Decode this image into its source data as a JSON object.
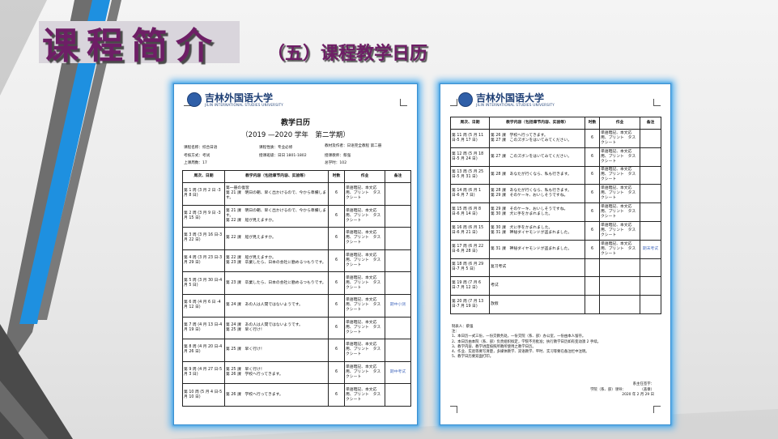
{
  "slide": {
    "title": "课程简介",
    "subtitle": "（五）课程教学日历",
    "colors": {
      "title": "#6e1e66",
      "glow": "#5ab3ef",
      "stripe_blue": "#1e90e0",
      "stripe_gray": "#6e6e6e"
    }
  },
  "logo": {
    "cn": "吉林外国语大学",
    "en": "JILIN INTERNATIONAL STUDIES UNIVERSITY"
  },
  "page1": {
    "doc_title": "教学日历",
    "year_line": "（2019 —2020 学年　第二学期）",
    "info": [
      "课程名称：综合日语",
      "课程性质：专业必修",
      "教材及作者：日语完全教程 第二册",
      "考核方式：考试",
      "授课班级：日日 1801-1802",
      "授课教师：蔡强",
      "上课周数：17",
      "总学时：102"
    ],
    "headers": [
      "周次、日期",
      "教学内容（包括章节内容、实验等）",
      "时数",
      "作业",
      "备注"
    ],
    "rows": [
      {
        "week": "第 1 周 (3 月 2 日 -3 月 8 日)",
        "content": "第一册の復習\n第 21 課　明日の朝、早く出かけるので、今から準備します。",
        "hours": "6",
        "homework": "単語暗記、本文応用、プリント　タスクシート",
        "note": ""
      },
      {
        "week": "第 2 周 (3 月 9 日 -3 月 15 日)",
        "content": "第 21 課　明日の朝、早く出かけるので、今から準備します。\n第 22 課　船が見えますか。",
        "hours": "6",
        "homework": "単語暗記、本文応用、プリント　タスクシート",
        "note": ""
      },
      {
        "week": "第 3 周 (3 月 16 日-3 月 22 日)",
        "content": "第 22 課　船が見えますか。",
        "hours": "6",
        "homework": "単語暗記、本文応用、プリント　タスクシート",
        "note": ""
      },
      {
        "week": "第 4 周 (3 月 23 日-3 月 29 日)",
        "content": "第 22 課　船が見えますか。\n第 23 課　卒業したら、日本の会社に勤めるつもりです。",
        "hours": "6",
        "homework": "単語暗記、本文応用、プリント　タスクシート",
        "note": ""
      },
      {
        "week": "第 5 周 (3 月 30 日-4 月 5 日)",
        "content": "第 23 課　卒業したら、日本の会社に勤めるつもりです。",
        "hours": "6",
        "homework": "単語暗記、本文応用、プリント　タスクシート",
        "note": ""
      },
      {
        "week": "第 6 周 (4 月 6 日 -4 月 12 日)",
        "content": "第 24 課　あの人は人間ではないようです。",
        "hours": "6",
        "homework": "単語暗記、本文応用、プリント　タスクシート",
        "note": "期中小测"
      },
      {
        "week": "第 7 周 (4 月 13 日-4 月 19 日)",
        "content": "第 24 課　あの人は人間ではないようです。\n第 25 課　早く行け！",
        "hours": "6",
        "homework": "単語暗記、本文応用、プリント　タスクシート",
        "note": ""
      },
      {
        "week": "第 8 周 (4 月 20 日-4 月 26 日)",
        "content": "第 25 課　早く行け！",
        "hours": "6",
        "homework": "単語暗記、本文応用、プリント　タスクシート",
        "note": ""
      },
      {
        "week": "第 9 周 (4 月 27 日-5 月 3 日)",
        "content": "第 25 課　早く行け！\n第 26 課　学校へ行ってきます。",
        "hours": "6",
        "homework": "単語暗記、本文応用、プリント　タスクシート",
        "note": "期中考试"
      },
      {
        "week": "第 10 周 (5 月 4 日-5 月 10 日)",
        "content": "第 26 課　学校へ行ってきます。",
        "hours": "6",
        "homework": "単語暗記、本文応用、プリント　タスクシート",
        "note": ""
      }
    ]
  },
  "page2": {
    "headers": [
      "周次、日期",
      "教学内容（包括章节内容、实验等）",
      "时数",
      "作业",
      "备注"
    ],
    "rows": [
      {
        "week": "第 11 周 (5 月 11 日-5 月 17 日)",
        "content": "第 26 課　学校へ行ってきます。\n第 27 課　このズボンをはいてみてください。",
        "hours": "6",
        "homework": "単語暗記、本文応用、プリント　タスクシート",
        "note": ""
      },
      {
        "week": "第 12 周 (5 月 18 日-5 月 24 日)",
        "content": "第 27 課　このズボンをはいてみてください。",
        "hours": "6",
        "homework": "単語暗記、本文応用、プリント　タスクシート",
        "note": ""
      },
      {
        "week": "第 13 周 (5 月 25 日-5 月 31 日)",
        "content": "第 28 課　あなたが行くなら、私も行きます。",
        "hours": "6",
        "homework": "単語暗記、本文応用、プリント　タスクシート",
        "note": ""
      },
      {
        "week": "第 14 周 (6 月 1 日-6 月 7 日)",
        "content": "第 28 課　あなたが行くなら、私も行きます。\n第 29 課　そのケーキ、おいしそうですね。",
        "hours": "6",
        "homework": "単語暗記、本文応用、プリント　タスクシート",
        "note": ""
      },
      {
        "week": "第 15 周 (6 月 8 日-6 月 14 日)",
        "content": "第 29 課　そのケーキ、おいしそうですね。\n第 30 課　犬に手をかまれました。",
        "hours": "6",
        "homework": "単語暗記、本文応用、プリント　タスクシート",
        "note": ""
      },
      {
        "week": "第 16 周 (6 月 15 日-6 月 21 日)",
        "content": "第 30 課　犬に手をかまれました。\n第 31 課　神秘ダイヤモンドが盗まれました。",
        "hours": "6",
        "homework": "単語暗記、本文応用、プリント　タスクシート",
        "note": ""
      },
      {
        "week": "第 17 周 (6 月 22 日-6 月 28 日)",
        "content": "第 31 課　神秘ダイヤモンドが盗まれました。",
        "hours": "6",
        "homework": "単語暗記、本文応用、プリント　タスクシート",
        "note": "期末考试"
      },
      {
        "week": "第 18 周 (6 月 29 日-7 月 5 日)",
        "content": "复习考试",
        "hours": "",
        "homework": "",
        "note": ""
      },
      {
        "week": "第 19 周 (7 月 6 日-7 月 12 日)",
        "content": "考试",
        "hours": "",
        "homework": "",
        "note": ""
      },
      {
        "week": "第 20 周 (7 月 13 日-7 月 19 日)",
        "content": "放假",
        "hours": "",
        "homework": "",
        "note": ""
      }
    ],
    "notes": [
      "制表人：蔡强",
      "注：",
      "1、本日历一式三份，一份交教务处，一份交院（系、部）办公室，一份由本人留存。",
      "2、本日历由本院（系、部）负责组织拟定，学院不另批准；执行教学日历如有变动须 2 手续。",
      "3、教学内容、教学进度按照所教所使用之教学日历。",
      "4、作业、实验等要写清楚，多媒体教学、双语教学、平时、实习等要在备注栏中注明。",
      "5、教学日历要双面打印。"
    ],
    "sign": [
      "系主任签字：",
      "学院（系、部）领导：　　　　　（盖章）",
      "2020 年 2 月 29 日"
    ]
  }
}
